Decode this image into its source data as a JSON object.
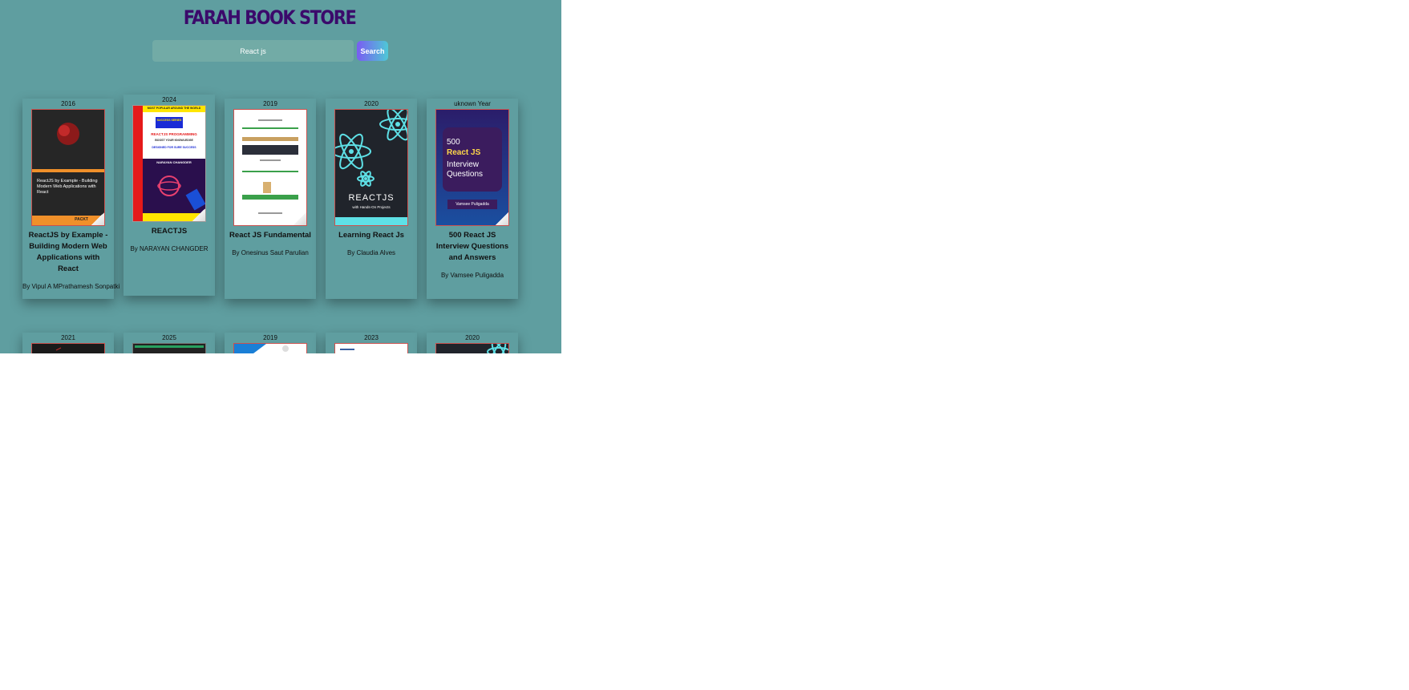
{
  "header": {
    "title": "FARAH BOOK STORE"
  },
  "search": {
    "value": "React js",
    "button_label": "Search"
  },
  "books": [
    {
      "year": "2016",
      "title": "ReactJS by Example - Building Modern Web Applications with React",
      "author": "By Vipul A MPrathamesh Sonpatki",
      "cover_text": "ReactJS by Example - Building Modern Web Applications with React",
      "cover_publisher": "PACKT"
    },
    {
      "year": "2024",
      "title": "REACTJS",
      "author": "By NARAYAN CHANGDER",
      "cover_top": "MOST POPULAR AROUND THE WORLD",
      "cover_series": "SUCCESS SERIES",
      "cover_main": "REACTJS PROGRAMMING",
      "cover_sub": "BOOST YOUR KNOWLEDGE",
      "cover_tag": "DESIGNED FOR SURE SUCCESS",
      "cover_author": "NARAYAN CHANGDER"
    },
    {
      "year": "2019",
      "title": "React JS Fundamental",
      "author": "By Onesinus Saut Parulian"
    },
    {
      "year": "2020",
      "title": "Learning React Js",
      "author": "By Claudia Alves",
      "cover_main": "REACTJS",
      "cover_sub": "with Hands-On Projects"
    },
    {
      "year": "uknown Year",
      "title": "500 React JS Interview Questions and Answers",
      "author": "By Vamsee Puligadda",
      "cover_number": "500",
      "cover_highlight": "React JS",
      "cover_rest": "Interview Questions",
      "cover_author": "Vamsee Puligadda"
    }
  ],
  "books_row2": [
    {
      "year": "2021"
    },
    {
      "year": "2025"
    },
    {
      "year": "2019"
    },
    {
      "year": "2023"
    },
    {
      "year": "2020"
    }
  ],
  "colors": {
    "page_bg": "#5f9ea0",
    "title": "#3b0a6b",
    "search_button_gradient": [
      "#7a5cf2",
      "#4ec8d6"
    ]
  }
}
